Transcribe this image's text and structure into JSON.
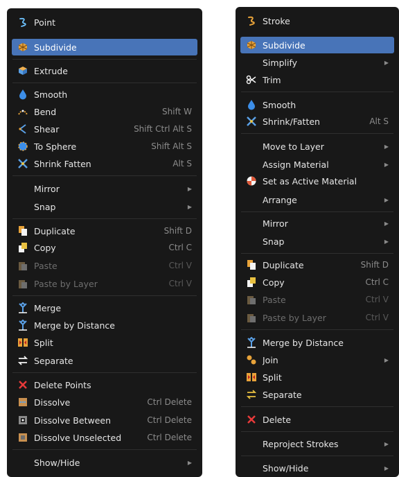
{
  "left_menu": {
    "title": "Point",
    "items": [
      {
        "label": "Subdivide",
        "icon": "subdivide-icon"
      },
      {
        "label": "Extrude",
        "icon": "extrude-icon"
      },
      {
        "label": "Smooth",
        "icon": "smooth-icon"
      },
      {
        "label": "Bend",
        "shortcut": "Shift W",
        "icon": "bend-icon"
      },
      {
        "label": "Shear",
        "shortcut": "Shift Ctrl Alt S",
        "icon": "shear-icon"
      },
      {
        "label": "To Sphere",
        "shortcut": "Shift Alt S",
        "icon": "to-sphere-icon"
      },
      {
        "label": "Shrink Fatten",
        "shortcut": "Alt S",
        "icon": "shrink-fatten-icon"
      },
      {
        "label": "Mirror"
      },
      {
        "label": "Snap"
      },
      {
        "label": "Duplicate",
        "shortcut": "Shift D",
        "icon": "duplicate-icon"
      },
      {
        "label": "Copy",
        "shortcut": "Ctrl C",
        "icon": "copy-icon"
      },
      {
        "label": "Paste",
        "shortcut": "Ctrl V",
        "icon": "paste-icon"
      },
      {
        "label": "Paste by Layer",
        "shortcut": "Ctrl V",
        "icon": "paste-by-layer-icon"
      },
      {
        "label": "Merge",
        "icon": "merge-icon"
      },
      {
        "label": "Merge by Distance",
        "icon": "merge-by-distance-icon"
      },
      {
        "label": "Split",
        "icon": "split-icon"
      },
      {
        "label": "Separate",
        "icon": "separate-icon"
      },
      {
        "label": "Delete Points",
        "icon": "delete-icon"
      },
      {
        "label": "Dissolve",
        "shortcut": "Ctrl Delete",
        "icon": "dissolve-icon"
      },
      {
        "label": "Dissolve Between",
        "shortcut": "Ctrl Delete",
        "icon": "dissolve-between-icon"
      },
      {
        "label": "Dissolve Unselected",
        "shortcut": "Ctrl Delete",
        "icon": "dissolve-unselected-icon"
      },
      {
        "label": "Show/Hide"
      }
    ]
  },
  "right_menu": {
    "title": "Stroke",
    "items": [
      {
        "label": "Subdivide",
        "icon": "subdivide-icon"
      },
      {
        "label": "Simplify"
      },
      {
        "label": "Trim",
        "icon": "scissors-icon"
      },
      {
        "label": "Smooth",
        "icon": "smooth-icon"
      },
      {
        "label": "Shrink/Fatten",
        "shortcut": "Alt S",
        "icon": "shrink-fatten-icon"
      },
      {
        "label": "Move to Layer"
      },
      {
        "label": "Assign Material"
      },
      {
        "label": "Set as Active Material",
        "icon": "material-icon"
      },
      {
        "label": "Arrange"
      },
      {
        "label": "Mirror"
      },
      {
        "label": "Snap"
      },
      {
        "label": "Duplicate",
        "shortcut": "Shift D",
        "icon": "duplicate-icon"
      },
      {
        "label": "Copy",
        "shortcut": "Ctrl C",
        "icon": "copy-icon"
      },
      {
        "label": "Paste",
        "shortcut": "Ctrl V",
        "icon": "paste-icon"
      },
      {
        "label": "Paste by Layer",
        "shortcut": "Ctrl V",
        "icon": "paste-by-layer-icon"
      },
      {
        "label": "Merge by Distance",
        "icon": "merge-by-distance-icon"
      },
      {
        "label": "Join",
        "icon": "join-icon"
      },
      {
        "label": "Split",
        "icon": "split-icon"
      },
      {
        "label": "Separate",
        "icon": "separate-icon"
      },
      {
        "label": "Delete",
        "icon": "delete-icon"
      },
      {
        "label": "Reproject Strokes"
      },
      {
        "label": "Show/Hide"
      }
    ]
  },
  "colors": {
    "menu_bg": "#181818",
    "highlight": "#4874b8",
    "text": "#e6e6e6",
    "shortcut": "#8c8c8c",
    "disabled": "#6e6e6e"
  }
}
